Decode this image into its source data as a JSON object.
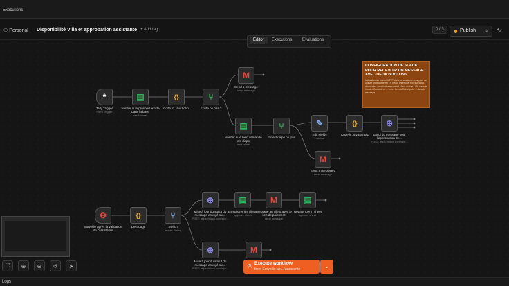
{
  "topbar": {
    "breadcrumb": "Executions"
  },
  "header": {
    "project": "Personal",
    "workflow_title": "Disponibilité Villa et approbation assistante",
    "add_tag": "+ Add tag",
    "version": "0 / 3",
    "publish": "Publish"
  },
  "tabs": [
    {
      "label": "Editor",
      "active": true
    },
    {
      "label": "Executions",
      "active": false
    },
    {
      "label": "Evaluations",
      "active": false
    }
  ],
  "nodes": {
    "tally": {
      "name": "Tally Trigger",
      "sub": "Form Trigger",
      "icon": "asterisk-icon",
      "glyph": "*"
    },
    "verify1": {
      "name": "Vérifier si le prospect existe dans la base",
      "sub": "read: sheet",
      "icon": "sheets-icon",
      "glyph": "▤"
    },
    "code1": {
      "name": "Code in JavaScript",
      "sub": "",
      "icon": "code-braces-icon",
      "glyph": "{}"
    },
    "ifexists": {
      "name": "Existe ou pas ?",
      "sub": "",
      "icon": "if-branch-icon",
      "glyph": "⑂"
    },
    "send1": {
      "name": "Send a message",
      "sub": "send message",
      "icon": "gmail-icon",
      "glyph": "M"
    },
    "verify2": {
      "name": "Vérifier si le bien demandé est dispo",
      "sub": "read: sheet",
      "icon": "sheets-icon",
      "glyph": "▤"
    },
    "ifdispo": {
      "name": "If c'est dispo ou pas",
      "sub": "",
      "icon": "if-branch-icon",
      "glyph": "⑂"
    },
    "edit": {
      "name": "Edit Fields",
      "sub": "manual",
      "icon": "pen-icon",
      "glyph": "✎"
    },
    "code2": {
      "name": "Code in JavaScript1",
      "sub": "",
      "icon": "code-braces-icon",
      "glyph": "{}"
    },
    "http1": {
      "name": "Envoi du message pour l'approbation de...",
      "sub": "POST: https://slack.com/api/...",
      "icon": "globe-icon",
      "glyph": "⊕"
    },
    "send2": {
      "name": "Send a message1",
      "sub": "send message",
      "icon": "gmail-icon",
      "glyph": "M"
    },
    "webhook": {
      "name": "Surveille après la validation de l'assistante",
      "sub": "",
      "icon": "webhook-icon",
      "glyph": "⚙"
    },
    "decode": {
      "name": "Decodage",
      "sub": "",
      "icon": "code-braces-icon",
      "glyph": "{}"
    },
    "switch": {
      "name": "Switch",
      "sub": "mode: Rules",
      "icon": "switch-icon",
      "glyph": "⑂"
    },
    "http2": {
      "name": "Mise à jour du statut du message envoyé sur...",
      "sub": "POST: https://slack.com/api/...",
      "icon": "globe-icon",
      "glyph": "⊕"
    },
    "record": {
      "name": "Enregistrer les clients",
      "sub": "append: sheet",
      "icon": "sheets-icon",
      "glyph": "▤"
    },
    "msgclient": {
      "name": "Message au client avec le lien de paiement",
      "sub": "send message",
      "icon": "gmail-icon",
      "glyph": "M"
    },
    "update": {
      "name": "Update row in sheet",
      "sub": "update: sheet",
      "icon": "sheets-icon",
      "glyph": "▤"
    },
    "http3": {
      "name": "Mise à jour du statut du message envoyé sur...",
      "sub": "POST: https://slack.com/api/...",
      "icon": "globe-icon",
      "glyph": "⊕"
    },
    "send3": {
      "name": "",
      "sub": "",
      "icon": "gmail-icon",
      "glyph": "M"
    }
  },
  "sticky_note": {
    "title": "CONFIGURATION DE SLACK POUR RECEVOIR UN MESSAGE AVEC DEUX BOUTONS",
    "body": "Utilisation du noeud HTTP dans ce workflow pour plus ne utiliser un requête HTTP. Il faut créer une app sur slack donner les autorisations correct il faut activer URL dans le header Content- et ... créer lien de Bot et puis ... dans le message"
  },
  "execute": {
    "label": "Execute workflow",
    "sub": "from Surveille ap...l'assistante"
  },
  "footer": {
    "logs": "Logs"
  },
  "colors": {
    "accent": "#ef5f22",
    "sticky": "#8a4510"
  }
}
